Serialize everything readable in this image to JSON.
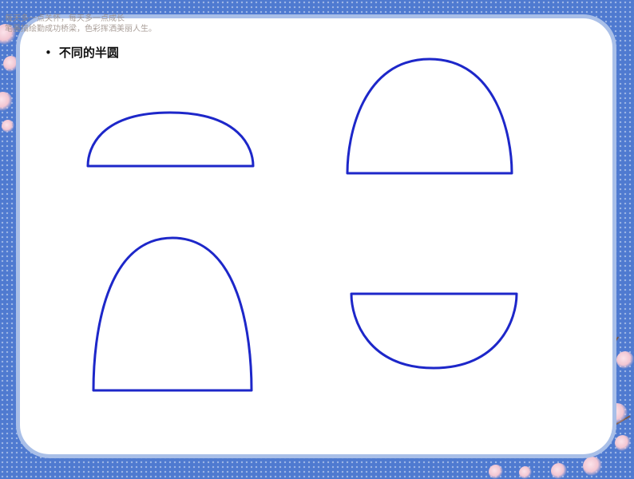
{
  "header": {
    "motto": "每天多一点关怀，每天多一点成长\n笔墨描绘勤成功桥梁，色彩挥洒美丽人生。"
  },
  "slide": {
    "bullet_symbol": "•",
    "bullet_text": "不同的半圆"
  },
  "colors": {
    "background": "#4f7ad0",
    "card_border": "#a9bfe8",
    "stroke": "#1d27c9"
  }
}
